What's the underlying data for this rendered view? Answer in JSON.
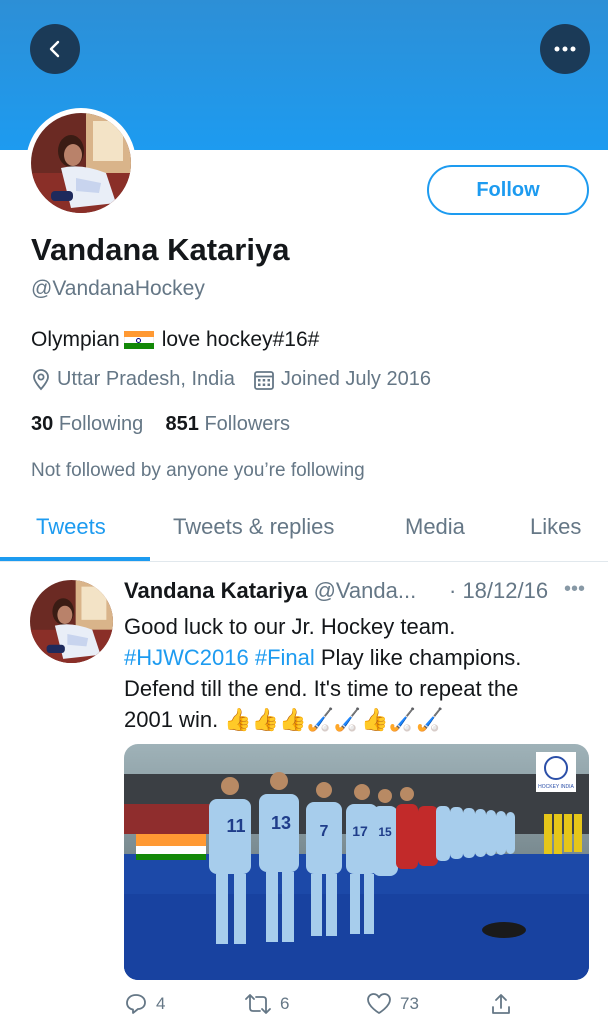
{
  "header": {
    "back_icon": "chevron-left-icon",
    "more_icon": "more-horizontal-icon"
  },
  "profile": {
    "name": "Vandana Katariya",
    "handle": "@VandanaHockey",
    "bio_before_flag": "Olympian",
    "bio_after_flag": "love hockey#16#",
    "location": "Uttar Pradesh, India",
    "joined": "Joined July 2016",
    "following_count": "30",
    "following_label": "Following",
    "followers_count": "851",
    "followers_label": "Followers",
    "not_followed": "Not followed by anyone you’re following",
    "follow_label": "Follow"
  },
  "tabs": [
    {
      "label": "Tweets",
      "active": true
    },
    {
      "label": "Tweets & replies",
      "active": false
    },
    {
      "label": "Media",
      "active": false
    },
    {
      "label": "Likes",
      "active": false
    }
  ],
  "tweet": {
    "name": "Vandana Katariya",
    "handle": "@Vanda...",
    "date": "· 18/12/16",
    "line1": "Good luck to our Jr. Hockey team.",
    "tag1": "#HJWC2016",
    "tag2": "#Final",
    "line2_rest": " Play like champions.",
    "line3": "Defend till the end. It's time to repeat the",
    "line4": "2001 win.",
    "emojis": "👍👍👍🏑🏑👍🏑🏑",
    "image_logo_text": "HOCKEY INDIA",
    "replies": "4",
    "retweets": "6",
    "likes": "73"
  },
  "colors": {
    "accent": "#1d9bf0",
    "muted": "#657786",
    "banner": "#2d8fd6"
  }
}
